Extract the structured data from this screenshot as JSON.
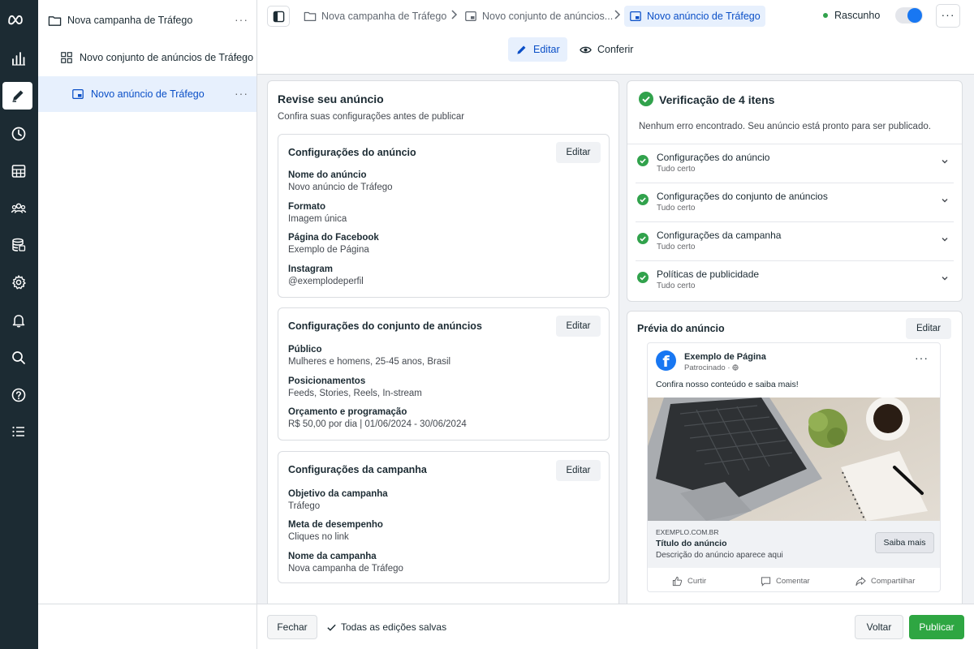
{
  "brand": {
    "accent": "#1877f2",
    "rail_bg": "#1c2b33",
    "success": "#31a24c"
  },
  "rail": {
    "items": [
      "meta-logo",
      "bar-chart-icon",
      "pencil-icon",
      "clock-icon",
      "table-icon",
      "people-icon",
      "database-icon",
      "gear-icon",
      "bell-icon",
      "search-icon",
      "help-icon",
      "list-icon"
    ],
    "active": "pencil-icon"
  },
  "tree": {
    "campaign": {
      "label": "Nova campanha de Tráfego",
      "more": "···"
    },
    "adset": {
      "label": "Novo conjunto de anúncios de Tráfego",
      "more": "···"
    },
    "ad": {
      "label": "Novo anúncio de Tráfego",
      "more": "···"
    }
  },
  "header": {
    "breadcrumbs": [
      "Nova campanha de Tráfego",
      "Novo conjunto de anúncios...",
      "Novo anúncio de Tráfego"
    ],
    "status": "Rascunho",
    "more": "···",
    "tabs": {
      "edit": "Editar",
      "review": "Conferir"
    }
  },
  "review": {
    "title": "Revise seu anúncio",
    "subtitle": "Confira suas configurações antes de publicar",
    "sections": [
      {
        "title": "Configurações do anúncio",
        "edit": "Editar",
        "fields": [
          {
            "label": "Nome do anúncio",
            "value": "Novo anúncio de Tráfego"
          },
          {
            "label": "Formato",
            "value": "Imagem única"
          },
          {
            "label": "Página do Facebook",
            "value": "Exemplo de Página"
          },
          {
            "label": "Instagram",
            "value": "@exemplodeperfil"
          }
        ]
      },
      {
        "title": "Configurações do conjunto de anúncios",
        "edit": "Editar",
        "fields": [
          {
            "label": "Público",
            "value": "Mulheres e homens, 25-45 anos, Brasil"
          },
          {
            "label": "Posicionamentos",
            "value": "Feeds, Stories, Reels, In-stream"
          },
          {
            "label": "Orçamento e programação",
            "value": "R$ 50,00 por dia | 01/06/2024 - 30/06/2024"
          }
        ]
      },
      {
        "title": "Configurações da campanha",
        "edit": "Editar",
        "fields": [
          {
            "label": "Objetivo da campanha",
            "value": "Tráfego"
          },
          {
            "label": "Meta de desempenho",
            "value": "Cliques no link"
          },
          {
            "label": "Nome da campanha",
            "value": "Nova campanha de Tráfego"
          }
        ]
      }
    ]
  },
  "verification": {
    "title": "Verificação de 4 itens",
    "message": "Nenhum erro encontrado. Seu anúncio está pronto para ser publicado.",
    "items": [
      {
        "title": "Configurações do anúncio",
        "status": "Tudo certo"
      },
      {
        "title": "Configurações do conjunto de anúncios",
        "status": "Tudo certo"
      },
      {
        "title": "Configurações da campanha",
        "status": "Tudo certo"
      },
      {
        "title": "Políticas de publicidade",
        "status": "Tudo certo"
      }
    ]
  },
  "preview": {
    "title": "Prévia do anúncio",
    "edit": "Editar",
    "page_initial": "f",
    "page_name": "Exemplo de Página",
    "sponsored": "Patrocinado · ",
    "more": "···",
    "text": "Confira nosso conteúdo e saiba mais!",
    "domain": "EXEMPLO.COM.BR",
    "headline": "Título do anúncio",
    "description": "Descrição do anúncio aparece aqui",
    "cta": "Saiba mais",
    "actions": {
      "like": "Curtir",
      "comment": "Comentar",
      "share": "Compartilhar"
    }
  },
  "footer": {
    "close": "Fechar",
    "saved": "Todas as edições salvas",
    "back": "Voltar",
    "publish": "Publicar"
  }
}
